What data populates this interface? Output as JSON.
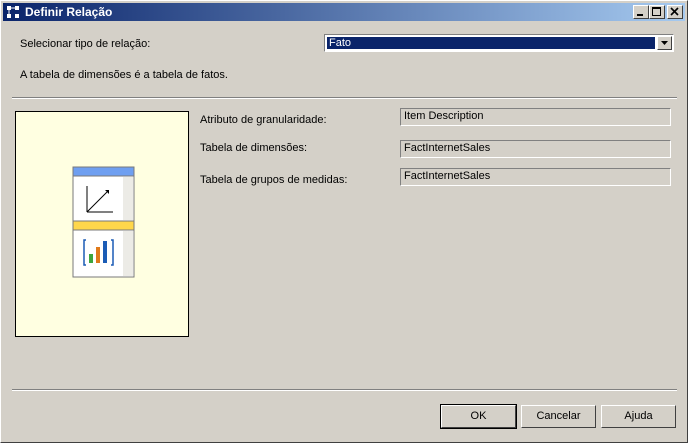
{
  "window": {
    "title": "Definir Relação",
    "controls": [
      "minimize-icon",
      "maximize-icon",
      "close-icon"
    ]
  },
  "relation_type": {
    "label": "Selecionar tipo de relação:",
    "selected": "Fato"
  },
  "description": "A tabela de dimensões é a tabela de fatos.",
  "fields": {
    "granularity": {
      "label": "Atributo de granularidade:",
      "value": "Item Description"
    },
    "dimension_table": {
      "label": "Tabela de dimensões:",
      "value": "FactInternetSales"
    },
    "measure_group_table": {
      "label": "Tabela de grupos de medidas:",
      "value": "FactInternetSales"
    }
  },
  "buttons": {
    "ok": "OK",
    "cancel": "Cancelar",
    "help": "Ajuda"
  },
  "colors": {
    "title_start": "#0a246a",
    "title_end": "#a6caf0",
    "preview_bg": "#ffffe1",
    "dimension_header": "#6f9ff0",
    "measure_header": "#ffd74b"
  }
}
